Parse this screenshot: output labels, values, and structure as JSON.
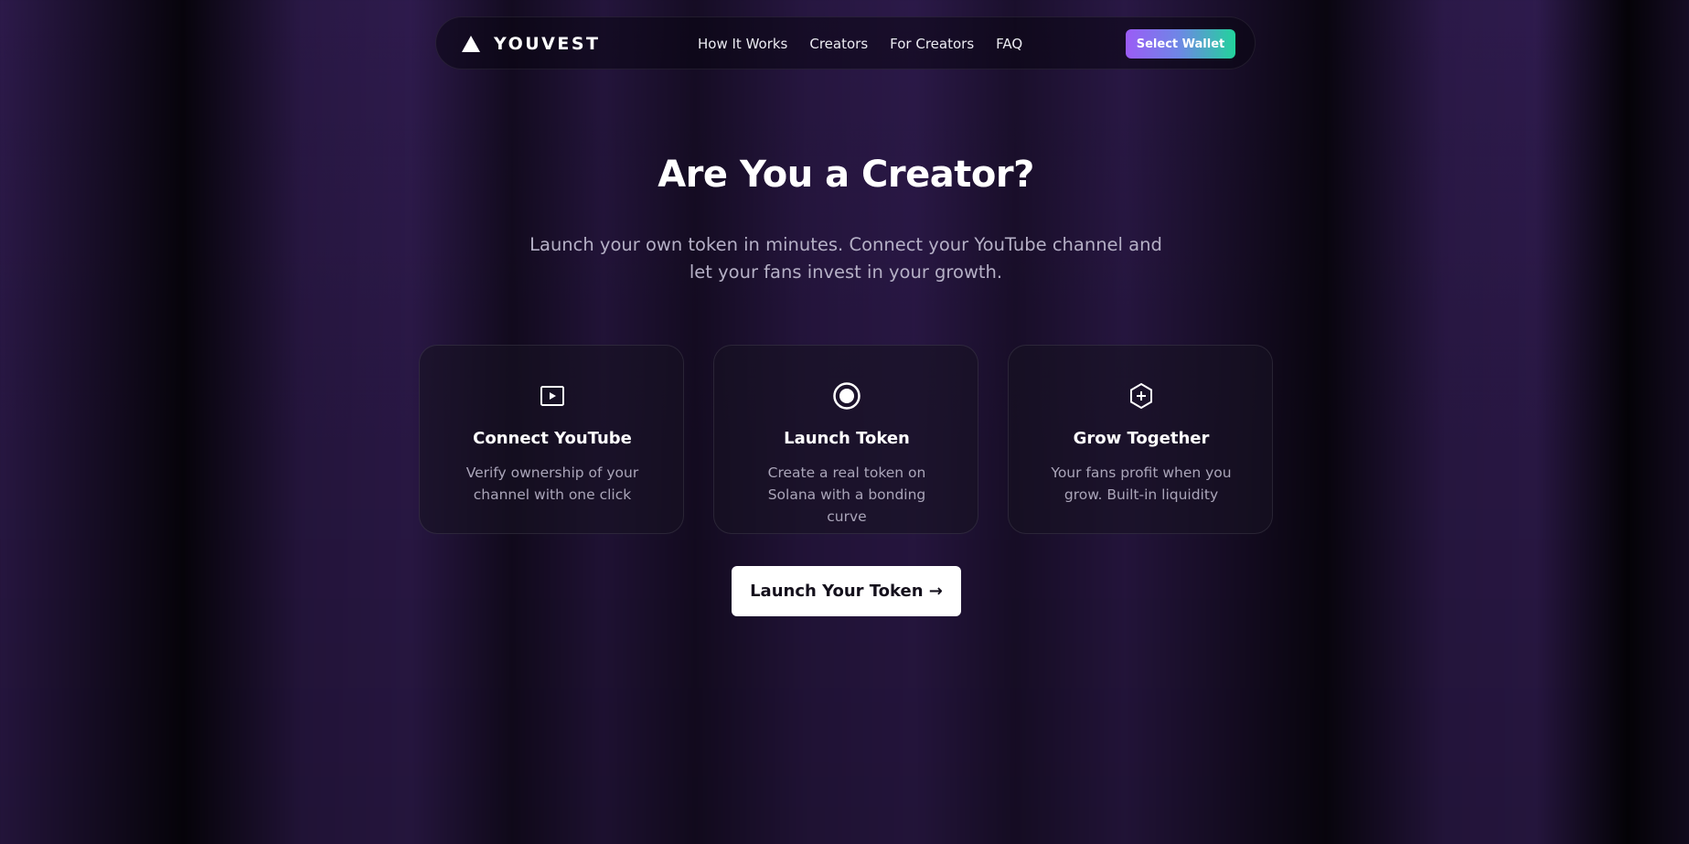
{
  "navbar": {
    "brand_icon": "triangle-logo-icon",
    "brand_name": "YOUVEST",
    "links": [
      {
        "label": "How It Works"
      },
      {
        "label": "Creators"
      },
      {
        "label": "For Creators"
      },
      {
        "label": "FAQ"
      }
    ],
    "wallet_button": "Select Wallet"
  },
  "hero": {
    "title": "Are You a Creator?",
    "subtitle": "Launch your own token in minutes. Connect your YouTube channel and let your fans invest in your growth."
  },
  "features": [
    {
      "icon": "video-play-icon",
      "title": "Connect YouTube",
      "description": "Verify ownership of your channel with one click"
    },
    {
      "icon": "record-circle-icon",
      "title": "Launch Token",
      "description": "Create a real token on Solana with a bonding curve"
    },
    {
      "icon": "hexagon-plus-icon",
      "title": "Grow Together",
      "description": "Your fans profit when you grow. Built-in liquidity"
    }
  ],
  "cta": {
    "label": "Launch Your Token →"
  },
  "colors": {
    "background": "#2a1846",
    "wallet_gradient_start": "#9b5cf6",
    "wallet_gradient_end": "#22d39c",
    "cta_background": "#ffffff",
    "cta_text": "#14101c"
  }
}
